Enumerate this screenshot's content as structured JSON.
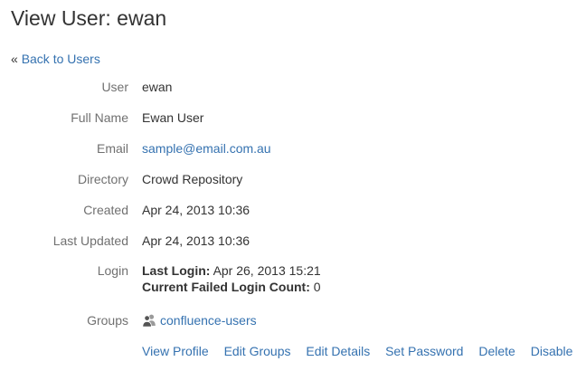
{
  "page": {
    "title": "View User: ewan"
  },
  "nav": {
    "back_prefix": "«",
    "back_label": "Back to Users"
  },
  "fields": {
    "user": {
      "label": "User",
      "value": "ewan"
    },
    "full_name": {
      "label": "Full Name",
      "value": "Ewan User"
    },
    "email": {
      "label": "Email",
      "value": "sample@email.com.au"
    },
    "directory": {
      "label": "Directory",
      "value": "Crowd Repository"
    },
    "created": {
      "label": "Created",
      "value": "Apr 24, 2013 10:36"
    },
    "last_updated": {
      "label": "Last Updated",
      "value": "Apr 24, 2013 10:36"
    },
    "login": {
      "label": "Login",
      "last_login_label": "Last Login:",
      "last_login_value": "Apr 26, 2013 15:21",
      "failed_count_label": "Current Failed Login Count:",
      "failed_count_value": "0"
    },
    "groups": {
      "label": "Groups",
      "icon": "group-icon",
      "items": [
        "confluence-users"
      ]
    }
  },
  "actions": {
    "view_profile": "View Profile",
    "edit_groups": "Edit Groups",
    "edit_details": "Edit Details",
    "set_password": "Set Password",
    "delete": "Delete",
    "disable": "Disable"
  },
  "colors": {
    "link": "#3572b0",
    "label": "#707070",
    "text": "#333333"
  }
}
